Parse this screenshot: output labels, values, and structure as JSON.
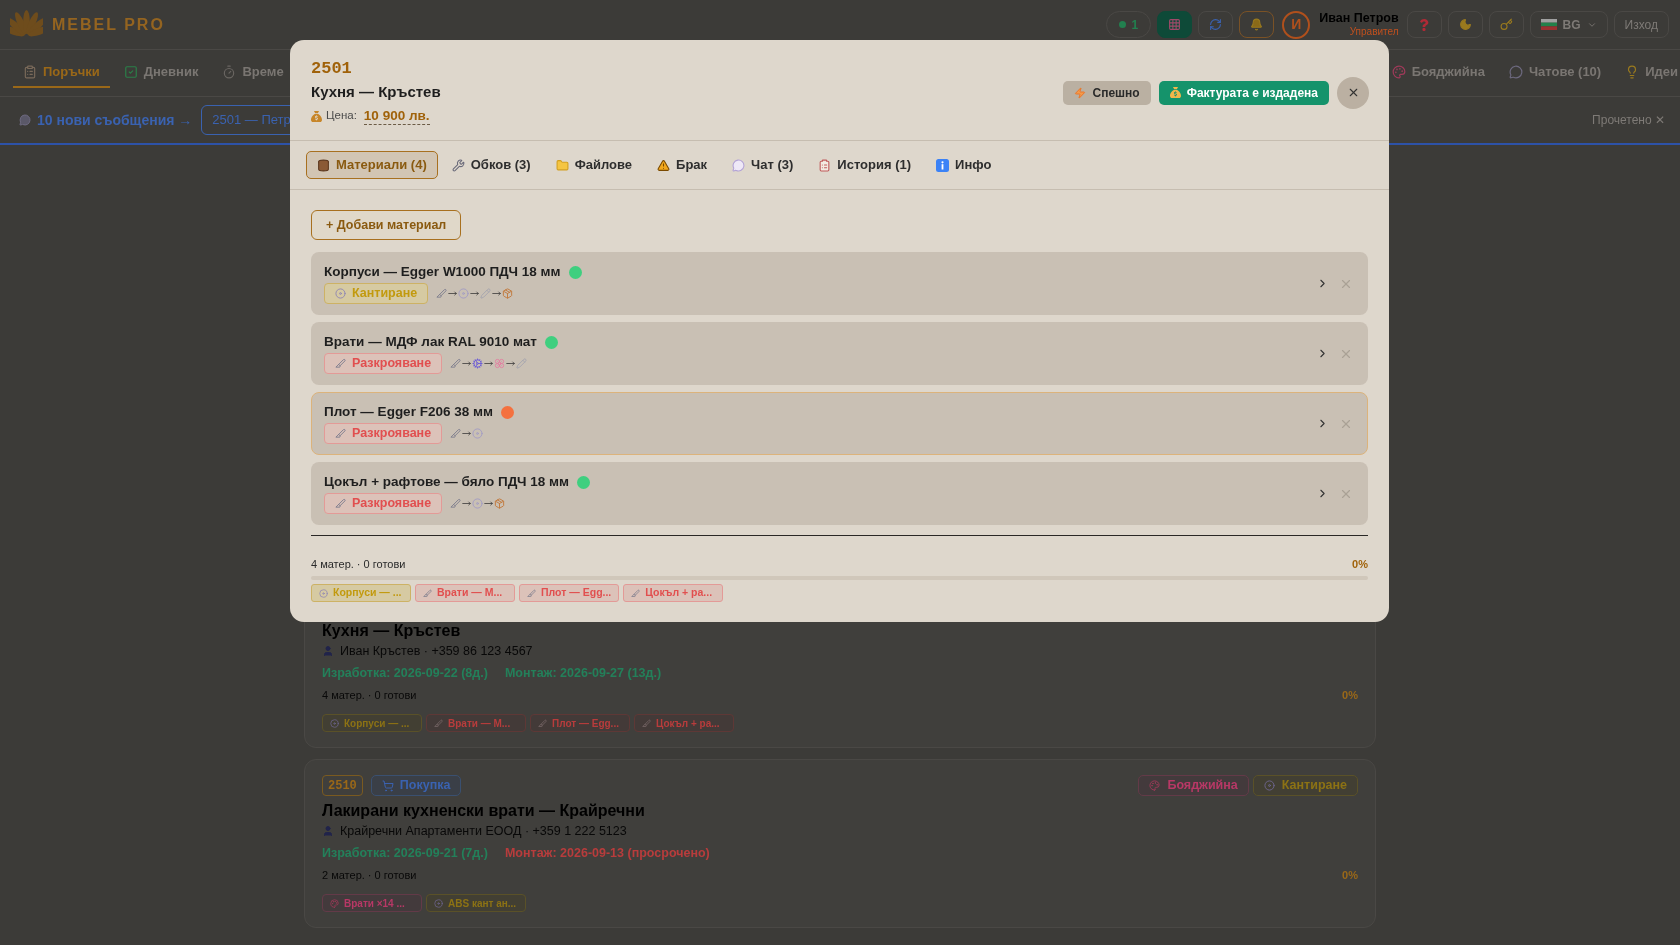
{
  "header": {
    "logo_text": "MEBEL PRO",
    "online_count": "1",
    "user": {
      "initial": "И",
      "name": "Иван Петров",
      "role": "Управител"
    },
    "language": "BG",
    "logout": "Изход"
  },
  "nav": {
    "left": [
      {
        "label": "Поръчки",
        "selected": true
      },
      {
        "label": "Дневник",
        "selected": false
      },
      {
        "label": "Време",
        "selected": false
      }
    ],
    "right": [
      {
        "label": "Бояджийна",
        "selected": false
      },
      {
        "label": "Чатове (10)",
        "selected": false
      },
      {
        "label": "Идеи",
        "selected": false
      }
    ]
  },
  "messages_bar": {
    "link": "10 нови съобщения →",
    "chip": "2501 — Петр",
    "dismiss": "Прочетено ✕"
  },
  "cards": [
    {
      "title": "Кухня — Кръстев",
      "contact": "Иван Кръстев · +359 86 123 4567",
      "dates": [
        {
          "text": "Изработка: 2026-09-22 (8д.)",
          "overdue": false
        },
        {
          "text": "Монтаж: 2026-09-27 (13д.)",
          "overdue": false
        }
      ],
      "materials_text": "4 матер. · 0 готови",
      "percent": "0%",
      "chips": [
        {
          "label": "Корпуси — ...",
          "kind": "edging"
        },
        {
          "label": "Врати — М...",
          "kind": "cutting"
        },
        {
          "label": "Плот — Egg...",
          "kind": "cutting"
        },
        {
          "label": "Цокъл + ра...",
          "kind": "cutting"
        }
      ]
    },
    {
      "number": "2510",
      "type": {
        "label": "Покупка",
        "kind": "purchase"
      },
      "stages": [
        {
          "label": "Бояджийна",
          "kind": "painting"
        },
        {
          "label": "Кантиране",
          "kind": "edging"
        }
      ],
      "title": "Лакирани кухненски врати — Крайречни",
      "contact": "Крайречни Апартаменти ЕООД · +359 1 222 5123",
      "dates": [
        {
          "text": "Изработка: 2026-09-21 (7д.)",
          "overdue": false
        },
        {
          "text": "Монтаж: 2026-09-13 (просрочено)",
          "overdue": true
        }
      ],
      "materials_text": "2 матер. · 0 готови",
      "percent": "0%",
      "chips": [
        {
          "label": "Врати ×14 ...",
          "kind": "painting"
        },
        {
          "label": "ABS кант ан...",
          "kind": "edging"
        }
      ]
    }
  ],
  "modal": {
    "number": "2501",
    "title": "Кухня — Кръстев",
    "price_label": "Цена:",
    "price": "10 900 лв.",
    "actions": [
      {
        "label": "Спешно",
        "kind": "urgent",
        "on": false
      },
      {
        "label": "Фактурата е издадена",
        "kind": "invoice",
        "on": true
      }
    ],
    "tabs": [
      {
        "label": "Материали (4)",
        "selected": true
      },
      {
        "label": "Обков (3)",
        "selected": false
      },
      {
        "label": "Файлове",
        "selected": false
      },
      {
        "label": "Брак",
        "selected": false
      },
      {
        "label": "Чат (3)",
        "selected": false
      },
      {
        "label": "История (1)",
        "selected": false
      },
      {
        "label": "Инфо",
        "selected": false
      }
    ],
    "add_button": "+ Добави материал",
    "materials": [
      {
        "name": "Корпуси — Egger W1000 ПДЧ 18 мм",
        "color": "#3fcf7f",
        "highlighted": false,
        "stage": {
          "label": "Кантиране",
          "kind": "edging"
        },
        "route": [
          {
            "kind": "cut"
          },
          {
            "kind": "edge"
          },
          {
            "kind": "drill"
          },
          {
            "kind": "pack"
          }
        ]
      },
      {
        "name": "Врати — МДФ лак RAL 9010 мат",
        "color": "#3fcf7f",
        "highlighted": false,
        "stage": {
          "label": "Разкрояване",
          "kind": "cutting"
        },
        "route": [
          {
            "kind": "cut"
          },
          {
            "kind": "cnc"
          },
          {
            "kind": "paint"
          },
          {
            "kind": "drill"
          }
        ]
      },
      {
        "name": "Плот — Egger F206 38 мм",
        "color": "#f4713f",
        "highlighted": true,
        "stage": {
          "label": "Разкрояване",
          "kind": "cutting"
        },
        "route": [
          {
            "kind": "cut"
          },
          {
            "kind": "edge"
          }
        ]
      },
      {
        "name": "Цокъл + рафтове — бяло ПДЧ 18 мм",
        "color": "#3fcf7f",
        "highlighted": false,
        "stage": {
          "label": "Разкрояване",
          "kind": "cutting"
        },
        "route": [
          {
            "kind": "cut"
          },
          {
            "kind": "edge"
          },
          {
            "kind": "pack"
          }
        ]
      }
    ],
    "summary": {
      "text": "4 матер. · 0 готови",
      "percent": "0%",
      "chips": [
        {
          "label": "Корпуси — ...",
          "kind": "edging"
        },
        {
          "label": "Врати — М...",
          "kind": "cutting"
        },
        {
          "label": "Плот — Egg...",
          "kind": "cutting"
        },
        {
          "label": "Цокъл + ра...",
          "kind": "cutting"
        }
      ]
    }
  }
}
